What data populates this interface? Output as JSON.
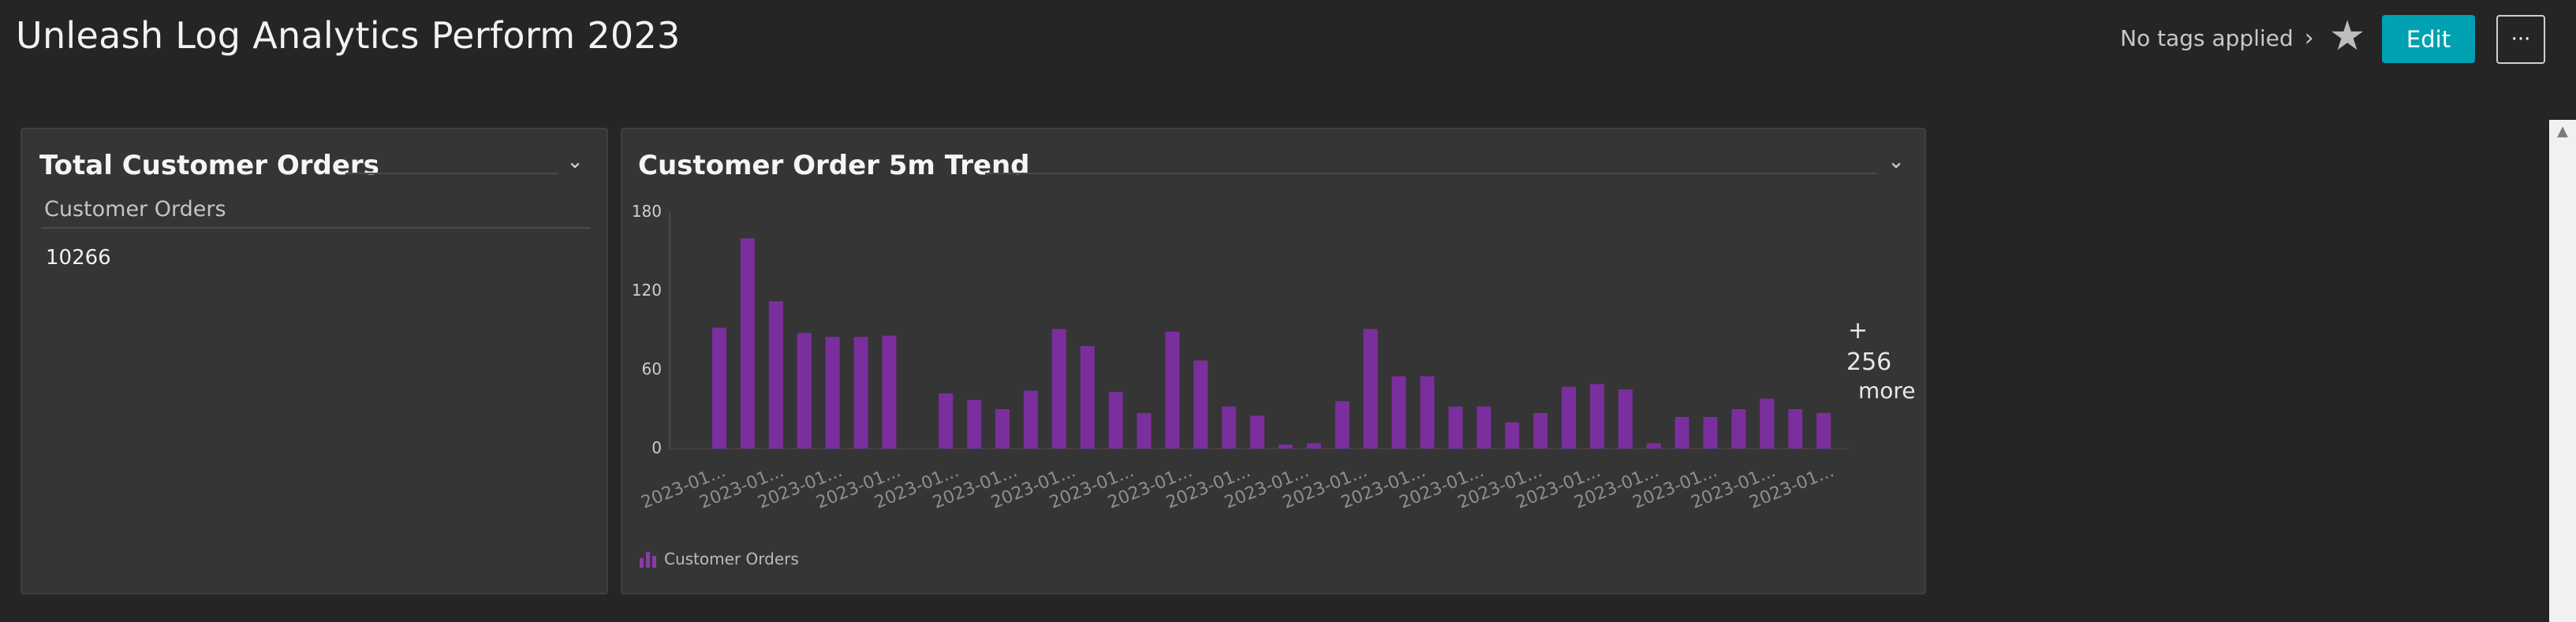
{
  "header": {
    "title": "Unleash Log Analytics Perform 2023",
    "tags_label": "No tags applied",
    "edit_label": "Edit",
    "more_label": "···"
  },
  "tiles": {
    "total_orders": {
      "title": "Total Customer Orders",
      "column": "Customer Orders",
      "value": "10266"
    },
    "trend": {
      "title": "Customer Order 5m Trend",
      "more_plus": "+",
      "more_count": "256",
      "more_word": "more",
      "legend_label": "Customer Orders"
    }
  },
  "colors": {
    "bar": "#7b2f9e",
    "accent": "#00a1b2",
    "background": "#252525",
    "tile": "#353535"
  },
  "chart_data": {
    "type": "bar",
    "ylim": [
      0,
      180
    ],
    "yticks": [
      "180",
      "120",
      "60",
      "0"
    ],
    "tick_label": "2023-01...",
    "categories": [
      "2023-01...",
      "2023-01...",
      "2023-01...",
      "2023-01...",
      "2023-01...",
      "2023-01...",
      "2023-01...",
      "2023-01...",
      "2023-01...",
      "2023-01...",
      "2023-01...",
      "2023-01...",
      "2023-01...",
      "2023-01...",
      "2023-01...",
      "2023-01...",
      "2023-01...",
      "2023-01...",
      "2023-01...",
      "2023-01...",
      "2023-01...",
      "2023-01...",
      "2023-01...",
      "2023-01...",
      "2023-01...",
      "2023-01...",
      "2023-01...",
      "2023-01...",
      "2023-01...",
      "2023-01...",
      "2023-01...",
      "2023-01...",
      "2023-01...",
      "2023-01...",
      "2023-01...",
      "2023-01...",
      "2023-01...",
      "2023-01...",
      "2023-01...",
      "2023-01...",
      "2023-01...",
      "2023-01...",
      "2023-01..."
    ],
    "series": [
      {
        "name": "Customer Orders",
        "values": [
          92,
          160,
          112,
          88,
          85,
          85,
          86,
          0,
          42,
          37,
          30,
          44,
          91,
          78,
          43,
          27,
          89,
          67,
          32,
          25,
          3,
          4,
          36,
          91,
          55,
          55,
          32,
          32,
          20,
          27,
          47,
          49,
          45,
          4,
          24,
          24,
          30,
          38,
          30,
          27
        ]
      }
    ],
    "legend": "bottom-left"
  }
}
